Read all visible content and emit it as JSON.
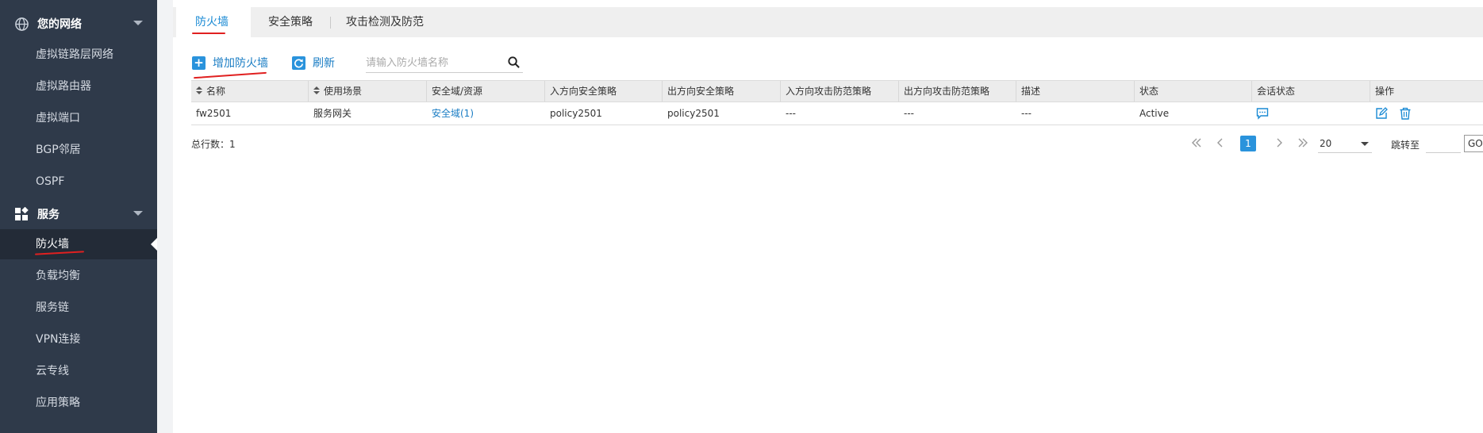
{
  "sidebar": {
    "network_group": {
      "label": "您的网络"
    },
    "network_items": [
      "虚拟链路层网络",
      "虚拟路由器",
      "虚拟端口",
      "BGP邻居",
      "OSPF"
    ],
    "service_group": {
      "label": "服务"
    },
    "service_items": [
      "防火墙",
      "负载均衡",
      "服务链",
      "VPN连接",
      "云专线",
      "应用策略"
    ],
    "active_item": "防火墙"
  },
  "tabs": [
    {
      "label": "防火墙",
      "active": true
    },
    {
      "label": "安全策略",
      "active": false
    },
    {
      "label": "攻击检测及防范",
      "active": false
    }
  ],
  "toolbar": {
    "add_label": "增加防火墙",
    "refresh_label": "刷新",
    "search_placeholder": "请输入防火墙名称"
  },
  "table": {
    "columns": [
      "名称",
      "使用场景",
      "安全域/资源",
      "入方向安全策略",
      "出方向安全策略",
      "入方向攻击防范策略",
      "出方向攻击防范策略",
      "描述",
      "状态",
      "会话状态",
      "操作"
    ],
    "rows": [
      {
        "name": "fw2501",
        "scene": "服务网关",
        "security_zone": "安全域(1)",
        "in_policy": "policy2501",
        "out_policy": "policy2501",
        "in_attack": "---",
        "out_attack": "---",
        "description": "---",
        "status": "Active"
      }
    ]
  },
  "pagination": {
    "total_label": "总行数：1",
    "current_page": "1",
    "page_size": "20",
    "jump_label": "跳转至",
    "go_label": "GO"
  },
  "colors": {
    "sidebar_bg": "#2f3a4a",
    "sidebar_active_bg": "#232b37",
    "accent": "#2a93dc",
    "annotation_red": "#e02020"
  }
}
